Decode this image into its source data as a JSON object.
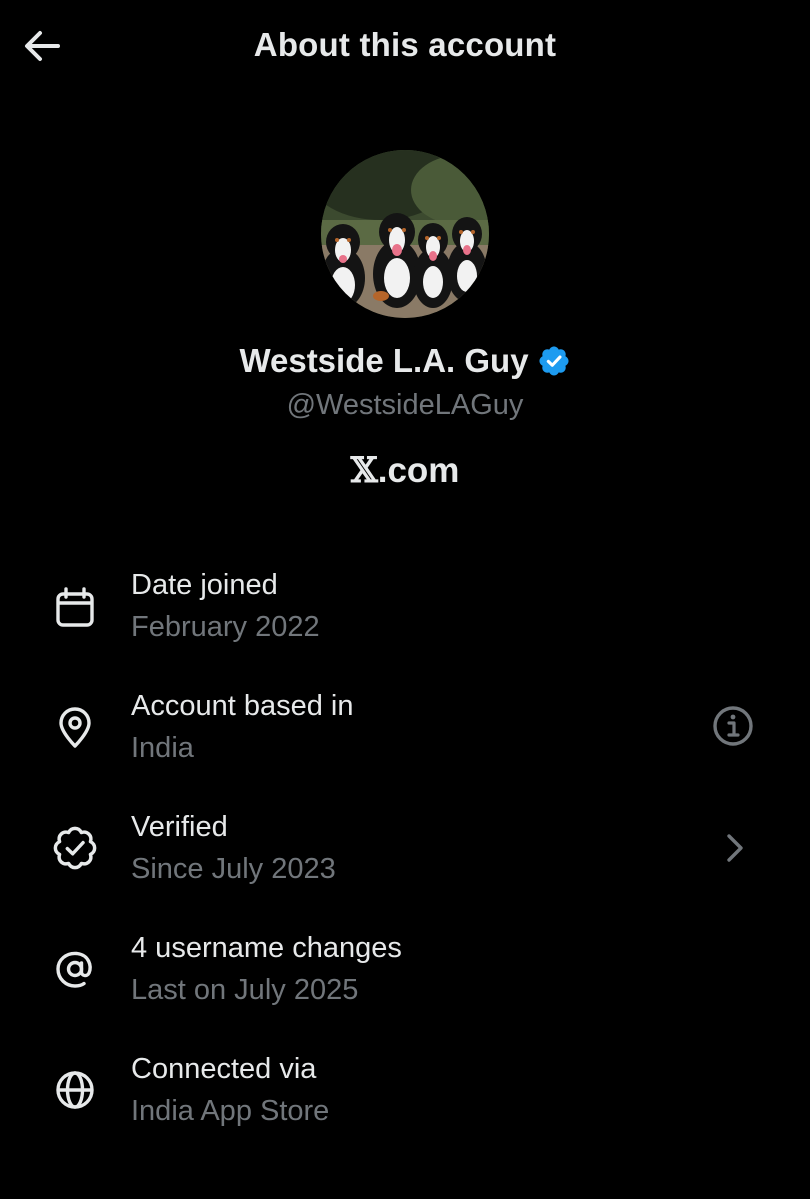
{
  "header": {
    "title": "About this account",
    "back_icon": "arrow-left-icon"
  },
  "profile": {
    "avatar_icon": "profile-photo-dogs",
    "display_name": "Westside L.A. Guy",
    "verified_badge_color": "#1d9bf0",
    "handle": "@WestsideLAGuy",
    "site_glyph": "𝕏",
    "site_suffix": ".com"
  },
  "rows": [
    {
      "icon": "calendar-icon",
      "title": "Date joined",
      "subtitle": "February 2022"
    },
    {
      "icon": "location-pin-icon",
      "title": "Account based in",
      "subtitle": "India",
      "action_icon": "info-icon"
    },
    {
      "icon": "verified-seal-icon",
      "title": "Verified",
      "subtitle": "Since July 2023",
      "action_icon": "chevron-right-icon"
    },
    {
      "icon": "at-sign-icon",
      "title": "4 username changes",
      "subtitle": "Last on July 2025"
    },
    {
      "icon": "globe-icon",
      "title": "Connected via",
      "subtitle": "India App Store"
    }
  ],
  "colors": {
    "background": "#000000",
    "primary_text": "#e7e9ea",
    "secondary_text": "#71767b",
    "accent": "#1d9bf0"
  }
}
